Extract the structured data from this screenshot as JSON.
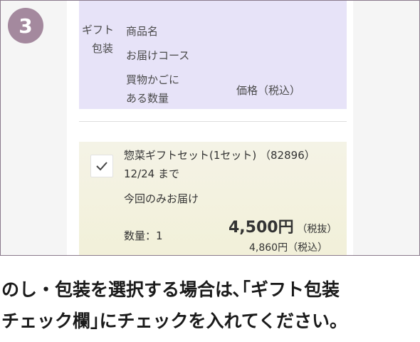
{
  "step": {
    "number": "3",
    "color": "#a4899e"
  },
  "header": {
    "gift_wrap_label_line1": "ギフト",
    "gift_wrap_label_line2": "包装",
    "product_name_label": "商品名",
    "delivery_course_label": "お届けコース",
    "quantity_label_line1": "買物かごに",
    "quantity_label_line2": "ある数量",
    "price_label": "価格（税込）"
  },
  "item": {
    "checked": true,
    "name": "惣菜ギフトセット(1セット) （82896）",
    "date": "12/24 まで",
    "delivery": "今回のみお届け",
    "quantity": "数量：1",
    "price_excl": "4,500円",
    "price_excl_note": "（税抜）",
    "price_incl": "4,860円（税込）"
  },
  "caption": {
    "line1": "のし・包装を選択する場合は､｢ギフト包装",
    "line2": "チェック欄｣にチェックを入れてください。"
  }
}
